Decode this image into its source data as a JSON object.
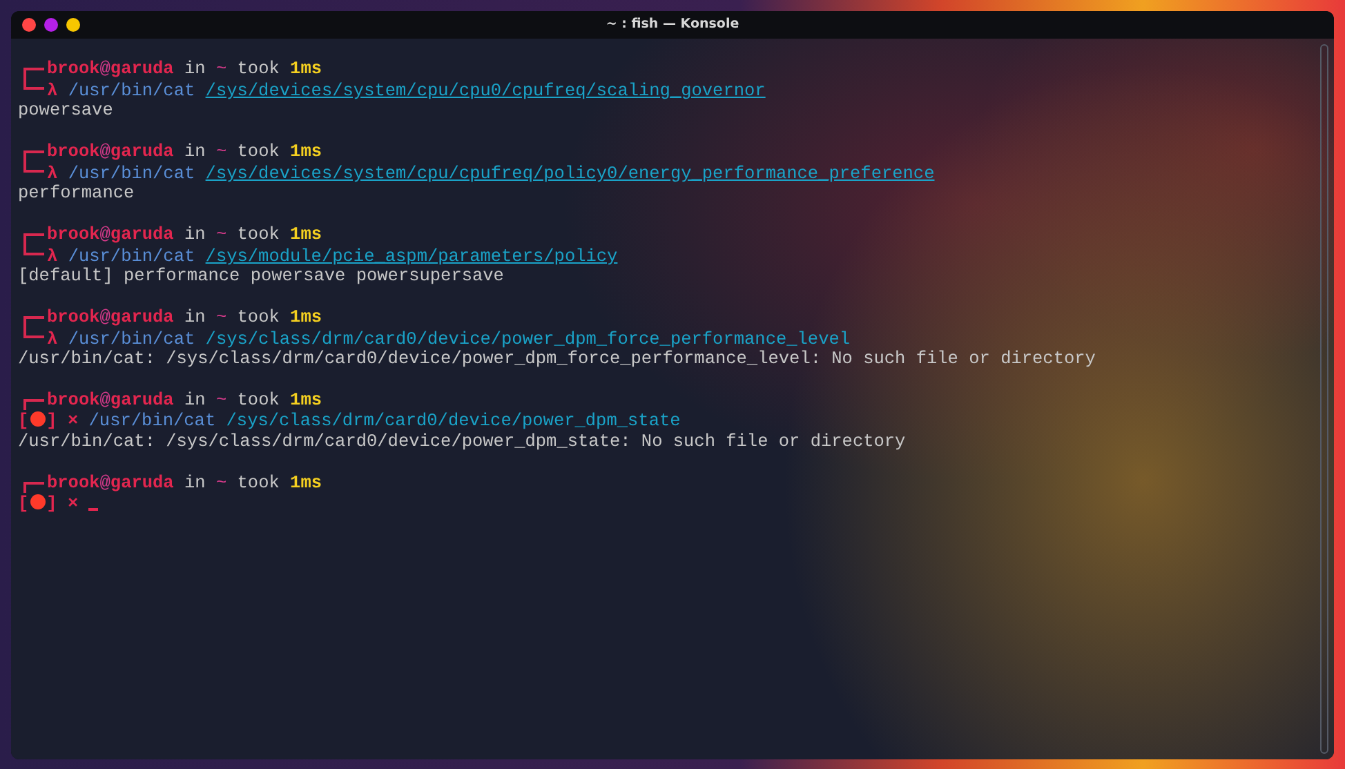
{
  "window": {
    "title": "~ : fish — Konsole"
  },
  "blocks": [
    {
      "user": "brook",
      "at": "@",
      "host": "garuda",
      "in": "in",
      "dir": "~",
      "took": "took",
      "duration": "1ms",
      "failed": false,
      "symbol": "λ",
      "command": "/usr/bin/cat",
      "argument": "/sys/devices/system/cpu/cpu0/cpufreq/scaling_governor",
      "argument_underlined": true,
      "output": "powersave"
    },
    {
      "user": "brook",
      "at": "@",
      "host": "garuda",
      "in": "in",
      "dir": "~",
      "took": "took",
      "duration": "1ms",
      "failed": false,
      "symbol": "λ",
      "command": "/usr/bin/cat",
      "argument": "/sys/devices/system/cpu/cpufreq/policy0/energy_performance_preference",
      "argument_underlined": true,
      "output": "performance"
    },
    {
      "user": "brook",
      "at": "@",
      "host": "garuda",
      "in": "in",
      "dir": "~",
      "took": "took",
      "duration": "1ms",
      "failed": false,
      "symbol": "λ",
      "command": "/usr/bin/cat",
      "argument": "/sys/module/pcie_aspm/parameters/policy",
      "argument_underlined": true,
      "output": "[default] performance powersave powersupersave"
    },
    {
      "user": "brook",
      "at": "@",
      "host": "garuda",
      "in": "in",
      "dir": "~",
      "took": "took",
      "duration": "1ms",
      "failed": false,
      "symbol": "λ",
      "command": "/usr/bin/cat",
      "argument": "/sys/class/drm/card0/device/power_dpm_force_performance_level",
      "argument_underlined": false,
      "output": "/usr/bin/cat: /sys/class/drm/card0/device/power_dpm_force_performance_level: No such file or directory"
    },
    {
      "user": "brook",
      "at": "@",
      "host": "garuda",
      "in": "in",
      "dir": "~",
      "took": "took",
      "duration": "1ms",
      "failed": true,
      "bracket_open": "[",
      "bracket_close": "]",
      "symbol": "×",
      "command": "/usr/bin/cat",
      "argument": "/sys/class/drm/card0/device/power_dpm_state",
      "argument_underlined": false,
      "output": "/usr/bin/cat: /sys/class/drm/card0/device/power_dpm_state: No such file or directory"
    },
    {
      "user": "brook",
      "at": "@",
      "host": "garuda",
      "in": "in",
      "dir": "~",
      "took": "took",
      "duration": "1ms",
      "failed": true,
      "bracket_open": "[",
      "bracket_close": "]",
      "symbol": "×",
      "cursor": true
    }
  ]
}
